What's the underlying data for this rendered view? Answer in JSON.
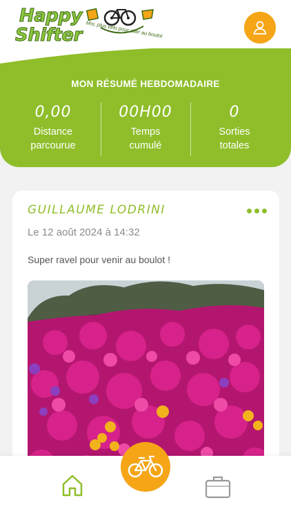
{
  "brand": {
    "line1": "Happy",
    "line2": "Shifter",
    "tagline": "Moi, plus vélo pour aller au boulot"
  },
  "colors": {
    "green": "#8fbe2a",
    "orange": "#f5a516"
  },
  "summary": {
    "title": "MON RÉSUMÉ HEBDOMADAIRE",
    "stats": [
      {
        "value": "0,00",
        "label_line1": "Distance",
        "label_line2": "parcourue"
      },
      {
        "value": "00H00",
        "label_line1": "Temps",
        "label_line2": "cumulé"
      },
      {
        "value": "0",
        "label_line1": "Sorties",
        "label_line2": "totales"
      }
    ]
  },
  "post": {
    "author": "GUILLAUME LODRINI",
    "date": "Le 12 août 2024 à 14:32",
    "description": "Super ravel pour venir au boulot !"
  },
  "icons": {
    "profile": "user-icon",
    "more": "more-dots-icon",
    "home": "home-icon",
    "ride": "bicycle-icon",
    "work": "briefcase-icon"
  }
}
